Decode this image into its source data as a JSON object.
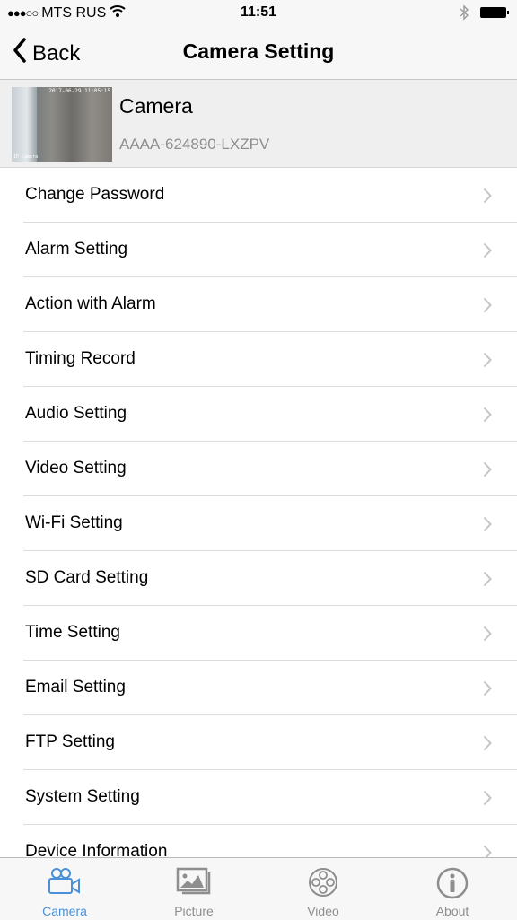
{
  "status_bar": {
    "signal": "●●●○○",
    "carrier": "MTS RUS",
    "time": "11:51"
  },
  "nav": {
    "back_label": "Back",
    "title": "Camera Setting"
  },
  "device": {
    "name": "Camera",
    "id": "AAAA-624890-LXZPV",
    "thumbnail_timestamp": "2017-06-29 11:05:15",
    "thumbnail_label": "IP Camera"
  },
  "menu": [
    {
      "label": "Change Password"
    },
    {
      "label": "Alarm Setting"
    },
    {
      "label": "Action with Alarm"
    },
    {
      "label": "Timing Record"
    },
    {
      "label": "Audio Setting"
    },
    {
      "label": "Video Setting"
    },
    {
      "label": "Wi-Fi Setting"
    },
    {
      "label": "SD Card Setting"
    },
    {
      "label": "Time Setting"
    },
    {
      "label": "Email Setting"
    },
    {
      "label": "FTP Setting"
    },
    {
      "label": "System Setting"
    },
    {
      "label": "Device Information"
    }
  ],
  "tabs": [
    {
      "label": "Camera",
      "icon": "camera-icon",
      "active": true
    },
    {
      "label": "Picture",
      "icon": "picture-icon",
      "active": false
    },
    {
      "label": "Video",
      "icon": "film-reel-icon",
      "active": false
    },
    {
      "label": "About",
      "icon": "info-icon",
      "active": false
    }
  ],
  "colors": {
    "accent": "#4a90d9",
    "inactive_tab": "#8e8e8e"
  }
}
